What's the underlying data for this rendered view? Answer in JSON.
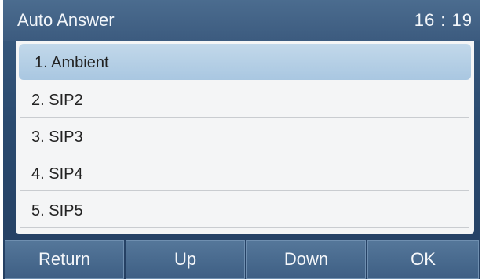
{
  "header": {
    "title": "Auto Answer",
    "time": "16 : 19"
  },
  "list": {
    "selected_index": 0,
    "items": [
      {
        "label": "1. Ambient"
      },
      {
        "label": "2. SIP2"
      },
      {
        "label": "3. SIP3"
      },
      {
        "label": "4. SIP4"
      },
      {
        "label": "5. SIP5"
      }
    ]
  },
  "softkeys": [
    {
      "label": "Return"
    },
    {
      "label": "Up"
    },
    {
      "label": "Down"
    },
    {
      "label": "OK"
    }
  ],
  "colors": {
    "background": "#2a4a6f",
    "titlebar": "#3c5b7f",
    "selection": "#a9c7e1",
    "list_background": "#f4f5f6"
  }
}
